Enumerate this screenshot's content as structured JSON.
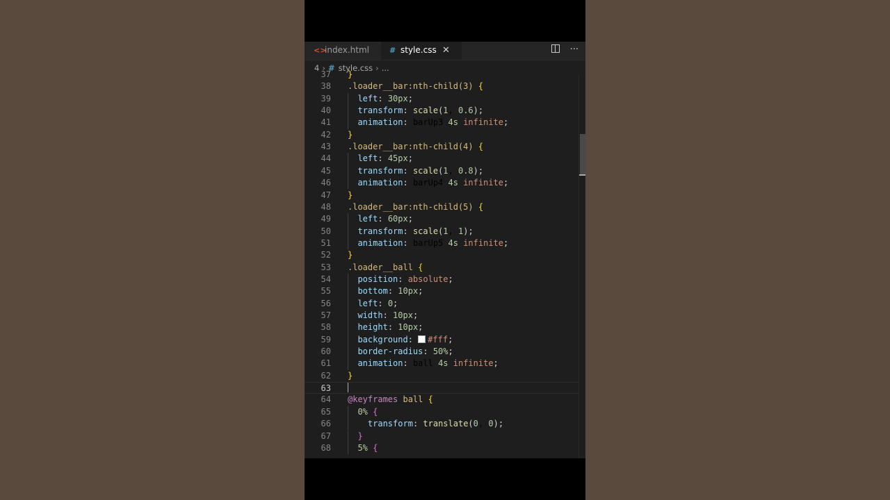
{
  "tabs": [
    {
      "icon": "html-file-icon",
      "label": "index.html",
      "active": false
    },
    {
      "icon": "css-file-icon",
      "label": "style.css",
      "active": true
    }
  ],
  "tab_close": "✕",
  "tab_actions": {
    "more": "···"
  },
  "breadcrumb": {
    "root": "4",
    "file": "style.css",
    "tail": "..."
  },
  "colors": {
    "editor_bg": "#1e1e1e",
    "selector": "#d7ba7d",
    "property": "#9cdcfe",
    "number": "#b5cea8",
    "keyword": "#ce9178",
    "function": "#dcdcaa",
    "at_rule": "#c586c0",
    "brace": "#ffd700"
  },
  "lines": [
    {
      "n": "37",
      "text": "}"
    },
    {
      "n": "38",
      "text": ".loader__bar:nth-child(3) {"
    },
    {
      "n": "39",
      "text": "  left: 30px;"
    },
    {
      "n": "40",
      "text": "  transform: scale(1, 0.6);"
    },
    {
      "n": "41",
      "text": "  animation: barUp3 4s infinite;"
    },
    {
      "n": "42",
      "text": "}"
    },
    {
      "n": "43",
      "text": ".loader__bar:nth-child(4) {"
    },
    {
      "n": "44",
      "text": "  left: 45px;"
    },
    {
      "n": "45",
      "text": "  transform: scale(1, 0.8);"
    },
    {
      "n": "46",
      "text": "  animation: barUp4 4s infinite;"
    },
    {
      "n": "47",
      "text": "}"
    },
    {
      "n": "48",
      "text": ".loader__bar:nth-child(5) {"
    },
    {
      "n": "49",
      "text": "  left: 60px;"
    },
    {
      "n": "50",
      "text": "  transform: scale(1, 1);"
    },
    {
      "n": "51",
      "text": "  animation: barUp5 4s infinite;"
    },
    {
      "n": "52",
      "text": "}"
    },
    {
      "n": "53",
      "text": ".loader__ball {"
    },
    {
      "n": "54",
      "text": "  position: absolute;"
    },
    {
      "n": "55",
      "text": "  bottom: 10px;"
    },
    {
      "n": "56",
      "text": "  left: 0;"
    },
    {
      "n": "57",
      "text": "  width: 10px;"
    },
    {
      "n": "58",
      "text": "  height: 10px;"
    },
    {
      "n": "59",
      "text": "  background: #fff;"
    },
    {
      "n": "60",
      "text": "  border-radius: 50%;"
    },
    {
      "n": "61",
      "text": "  animation: ball 4s infinite;"
    },
    {
      "n": "62",
      "text": "}"
    },
    {
      "n": "63",
      "text": ""
    },
    {
      "n": "64",
      "text": "@keyframes ball {"
    },
    {
      "n": "65",
      "text": "  0% {"
    },
    {
      "n": "66",
      "text": "    transform: translate(0, 0);"
    },
    {
      "n": "67",
      "text": "  }"
    },
    {
      "n": "68",
      "text": "  5% {"
    }
  ]
}
